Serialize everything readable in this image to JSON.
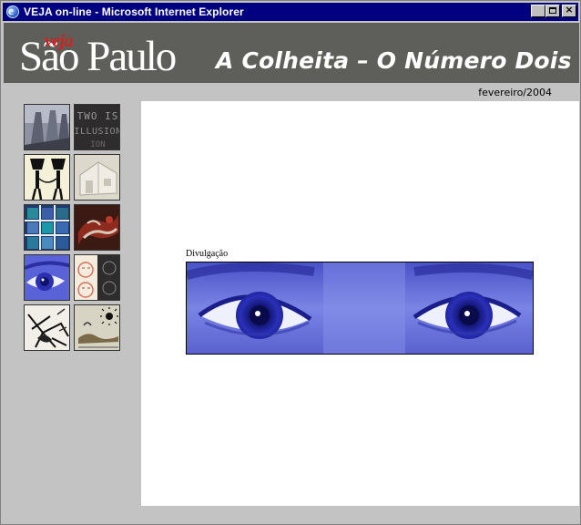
{
  "window": {
    "title": "VEJA on-line - Microsoft Internet Explorer",
    "buttons": {
      "minimize": "_",
      "close": "×"
    }
  },
  "header": {
    "logo_veja": "veja",
    "logo_city": "São Paulo",
    "title": "A Colheita – O Número Dois"
  },
  "date": "fevereiro/2004",
  "thumbnails": [
    {
      "name": "thumb-chairs",
      "description_icon": "image-thumbnail"
    },
    {
      "name": "thumb-two-is-illusion",
      "text": "TWO IS ILLUSION"
    },
    {
      "name": "thumb-figures"
    },
    {
      "name": "thumb-house"
    },
    {
      "name": "thumb-grid"
    },
    {
      "name": "thumb-red-painting"
    },
    {
      "name": "thumb-eye"
    },
    {
      "name": "thumb-faces"
    },
    {
      "name": "thumb-sketch"
    },
    {
      "name": "thumb-drawing-sun"
    }
  ],
  "main": {
    "credit": "Divulgação"
  },
  "colors": {
    "titlebar": "#000080",
    "header_bg": "#5e5f5b",
    "logo_red": "#d61f1f",
    "eye_blue": "#3a3ec4"
  }
}
